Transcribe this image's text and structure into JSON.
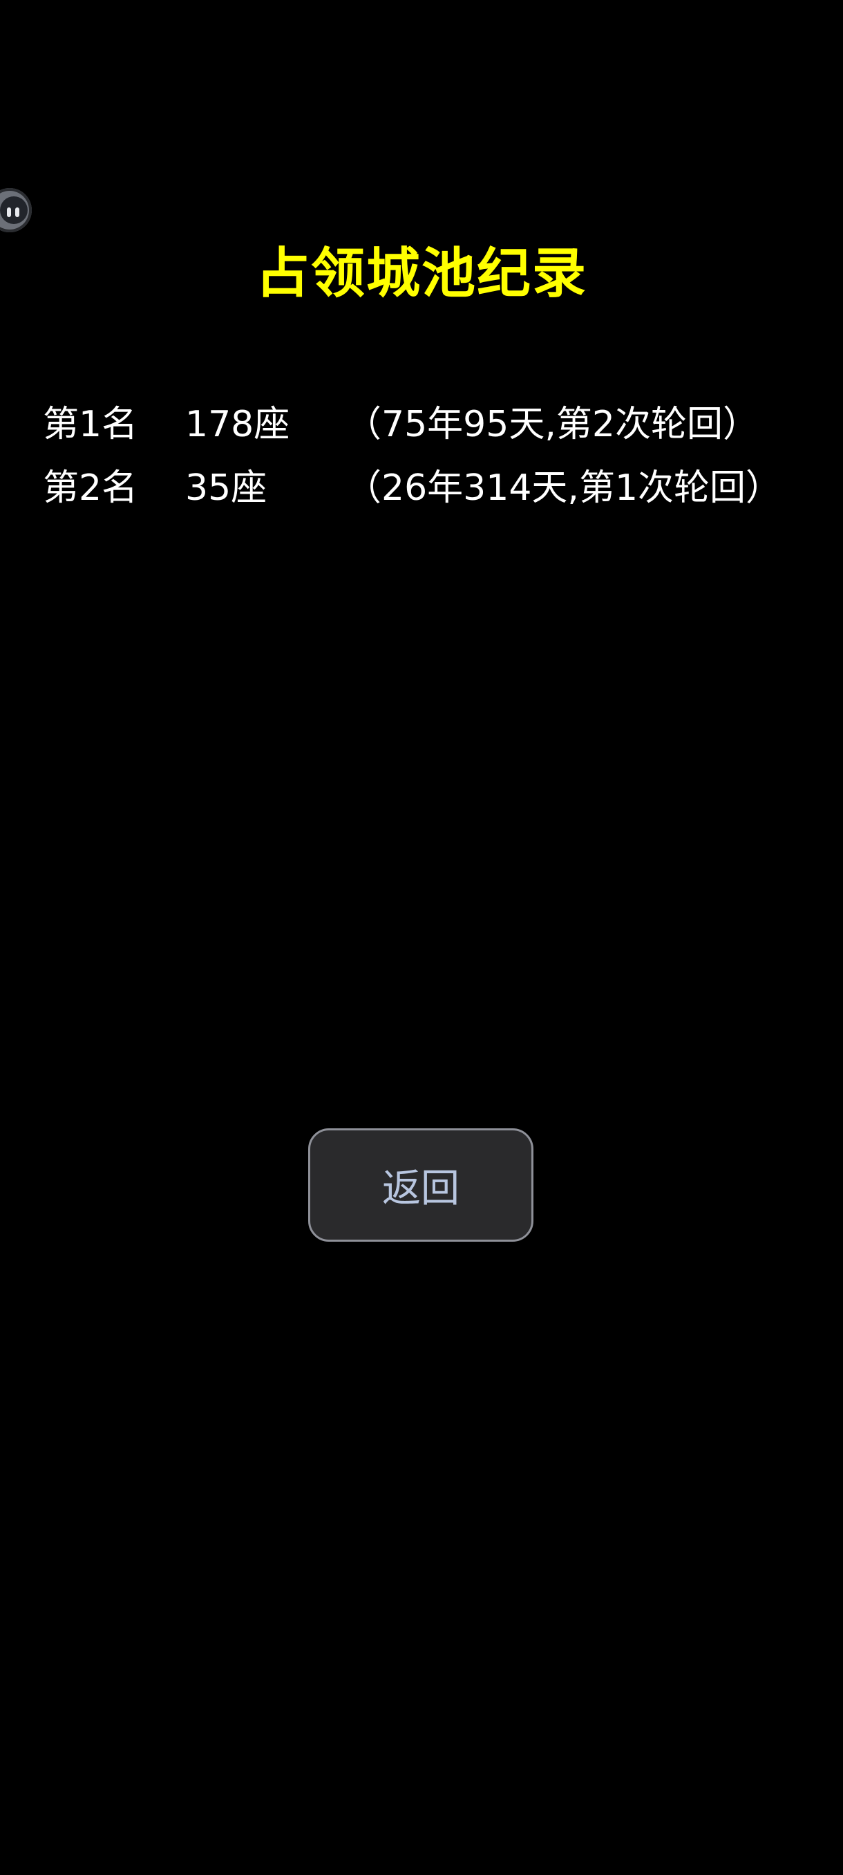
{
  "title": "占领城池纪录",
  "records": [
    {
      "rank": "第1名",
      "count": "178座",
      "detail": "（75年95天,第2次轮回）"
    },
    {
      "rank": "第2名",
      "count": "35座",
      "detail": "（26年314天,第1次轮回）"
    }
  ],
  "back_button": {
    "label": "返回"
  },
  "floating_widget": {
    "icon": "assistant-face-icon"
  },
  "colors": {
    "background": "#000000",
    "title": "#ffff00",
    "text": "#ffffff",
    "button_bg": "#2a2a2c",
    "button_text": "#b8c6e0"
  }
}
